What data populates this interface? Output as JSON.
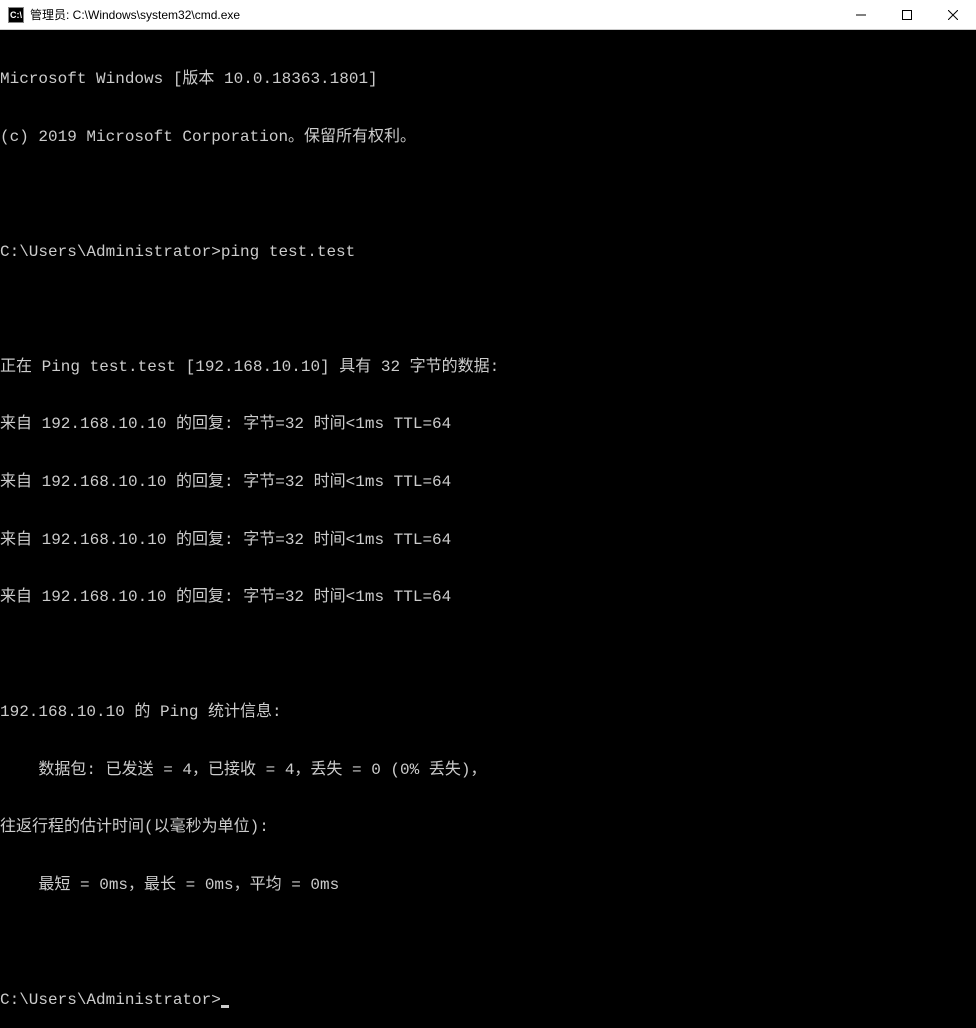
{
  "titlebar": {
    "icon_text": "C:\\",
    "title": "管理员: C:\\Windows\\system32\\cmd.exe"
  },
  "terminal": {
    "lines": [
      "Microsoft Windows [版本 10.0.18363.1801]",
      "(c) 2019 Microsoft Corporation。保留所有权利。",
      "",
      "C:\\Users\\Administrator>ping test.test",
      "",
      "正在 Ping test.test [192.168.10.10] 具有 32 字节的数据:",
      "来自 192.168.10.10 的回复: 字节=32 时间<1ms TTL=64",
      "来自 192.168.10.10 的回复: 字节=32 时间<1ms TTL=64",
      "来自 192.168.10.10 的回复: 字节=32 时间<1ms TTL=64",
      "来自 192.168.10.10 的回复: 字节=32 时间<1ms TTL=64",
      "",
      "192.168.10.10 的 Ping 统计信息:",
      "    数据包: 已发送 = 4，已接收 = 4，丢失 = 0 (0% 丢失)，",
      "往返行程的估计时间(以毫秒为单位):",
      "    最短 = 0ms，最长 = 0ms，平均 = 0ms",
      "",
      "C:\\Users\\Administrator>"
    ]
  },
  "bottom_hint": ""
}
